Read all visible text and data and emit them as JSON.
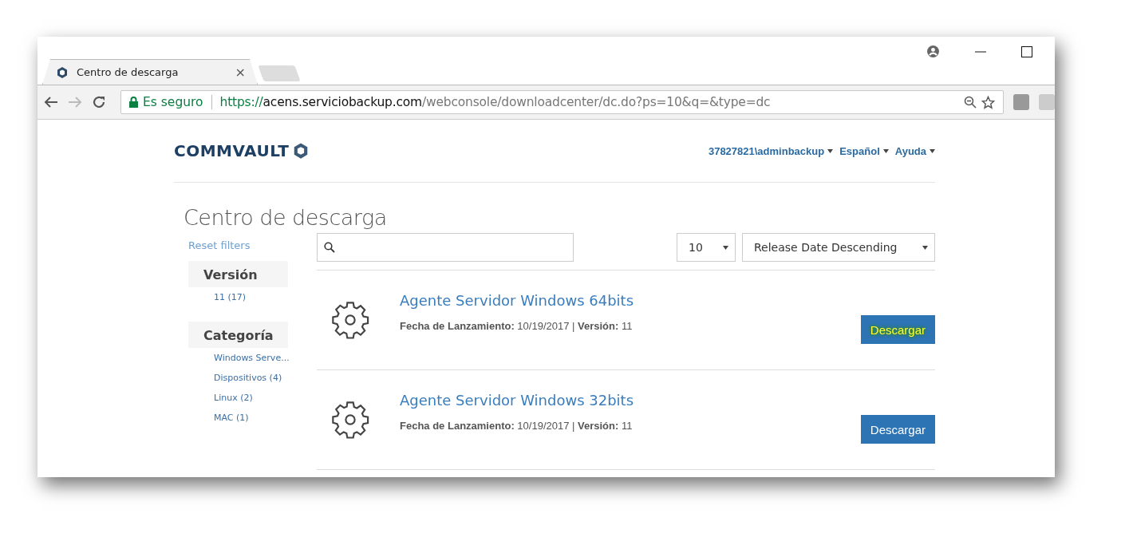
{
  "browser": {
    "tab": {
      "title": "Centro de descarga",
      "close": "×"
    },
    "security": "Es seguro",
    "url": {
      "scheme": "https://",
      "host": "acens.serviciobackup.com",
      "path": "/webconsole/downloadcenter/dc.do?ps=10&q=&type=dc"
    }
  },
  "header": {
    "logo": "COMMVAULT",
    "menus": [
      {
        "label": "37827821\\adminbackup"
      },
      {
        "label": "Español"
      },
      {
        "label": "Ayuda"
      }
    ]
  },
  "page": {
    "title": "Centro de descarga",
    "reset": "Reset filters",
    "filters": [
      {
        "heading": "Versión",
        "items": [
          "11 (17)"
        ]
      },
      {
        "heading": "Categoría",
        "items": [
          "Windows Serve...",
          "Dispositivos (4)",
          "Linux (2)",
          "MAC (1)"
        ]
      }
    ],
    "page_size": "10",
    "sort": "Release Date Descending",
    "results": [
      {
        "title": "Agente Servidor Windows 64bits",
        "meta": "**Fecha de Lanzamiento:** 10/19/2017 |  **Versión:** 11",
        "button": "Descargar",
        "highlighted": true
      },
      {
        "title": "Agente Servidor Windows 32bits",
        "meta": "**Fecha de Lanzamiento:** 10/19/2017 |  **Versión:** 11",
        "button": "Descargar",
        "highlighted": false
      }
    ]
  }
}
